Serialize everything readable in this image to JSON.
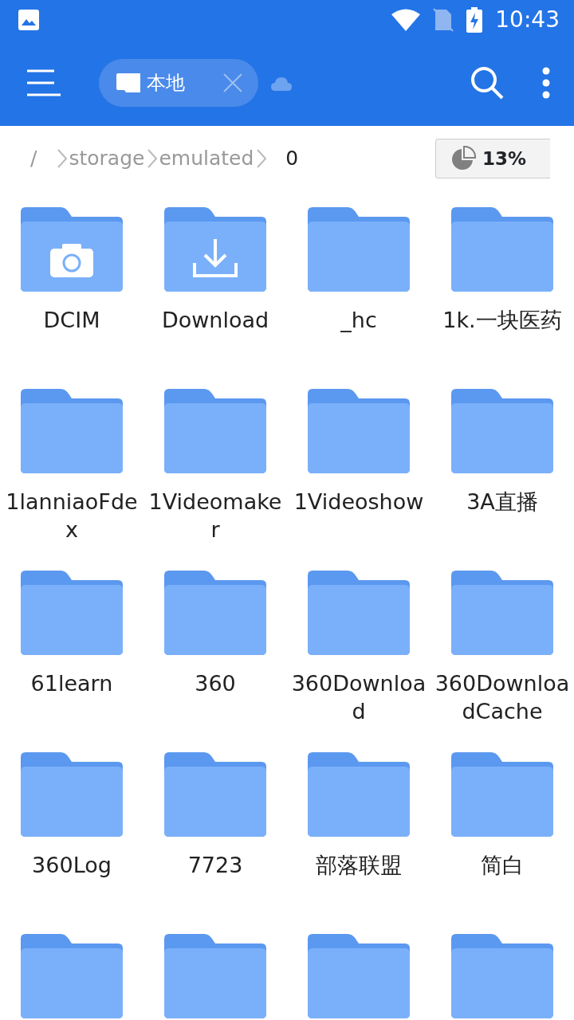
{
  "status_bar": {
    "time": "10:43"
  },
  "toolbar": {
    "tab": {
      "label": "本地",
      "selected": true
    }
  },
  "breadcrumb": [
    {
      "label": "/",
      "selected": false
    },
    {
      "label": "storage",
      "selected": false
    },
    {
      "label": "emulated",
      "selected": false
    },
    {
      "label": "0",
      "selected": true
    }
  ],
  "storage_usage": "13%",
  "folders": [
    {
      "name": "DCIM",
      "kind": "camera"
    },
    {
      "name": "Download",
      "kind": "download"
    },
    {
      "name": "_hc",
      "kind": "plain"
    },
    {
      "name": "1k.一块医药",
      "kind": "plain"
    },
    {
      "name": "1lanniaoFdex",
      "kind": "plain"
    },
    {
      "name": "1Videomaker",
      "kind": "plain"
    },
    {
      "name": "1Videoshow",
      "kind": "plain"
    },
    {
      "name": "3A直播",
      "kind": "plain"
    },
    {
      "name": "61learn",
      "kind": "plain"
    },
    {
      "name": "360",
      "kind": "plain"
    },
    {
      "name": "360Download",
      "kind": "plain"
    },
    {
      "name": "360DownloadCache",
      "kind": "plain"
    },
    {
      "name": "360Log",
      "kind": "plain"
    },
    {
      "name": "7723",
      "kind": "plain"
    },
    {
      "name": "部落联盟",
      "kind": "plain"
    },
    {
      "name": "简白",
      "kind": "plain"
    },
    {
      "kind": "plain"
    },
    {
      "kind": "plain"
    },
    {
      "kind": "plain"
    },
    {
      "kind": "plain"
    }
  ]
}
